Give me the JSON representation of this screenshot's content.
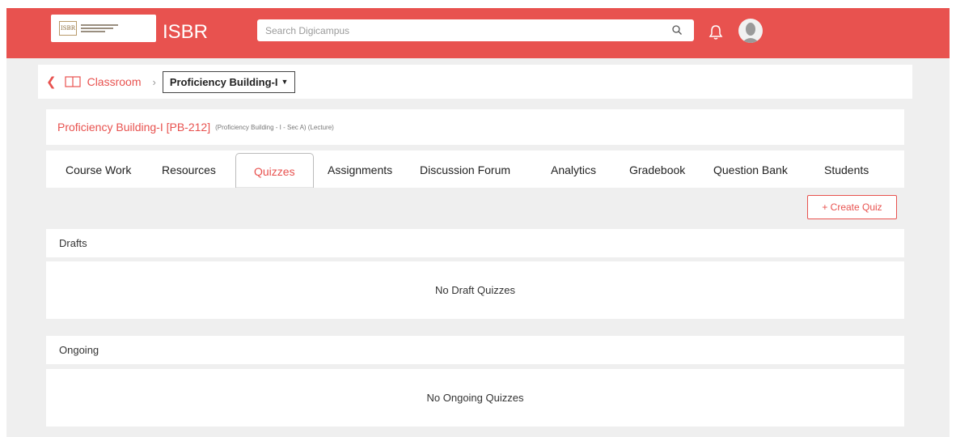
{
  "header": {
    "app_title": "ISBR",
    "logo_text": "ISBR",
    "search_placeholder": "Search Digicampus",
    "brand_color": "#e8524f"
  },
  "breadcrumb": {
    "back_icon": "chevron-left-icon",
    "classroom_label": "Classroom",
    "separator": "›",
    "course_dropdown": "Proficiency Building-I"
  },
  "course": {
    "title": "Proficiency Building-I [PB-212]",
    "meta": "(Proficiency Building - I - Sec A)  (Lecture)"
  },
  "tabs": [
    {
      "label": "Course Work"
    },
    {
      "label": "Resources"
    },
    {
      "label": "Quizzes",
      "active": true
    },
    {
      "label": "Assignments"
    },
    {
      "label": "Discussion Forum"
    },
    {
      "label": "Analytics"
    },
    {
      "label": "Gradebook"
    },
    {
      "label": "Question Bank"
    },
    {
      "label": "Students"
    }
  ],
  "actions": {
    "create_quiz": "+ Create Quiz"
  },
  "sections": {
    "drafts": {
      "title": "Drafts",
      "empty": "No Draft Quizzes"
    },
    "ongoing": {
      "title": "Ongoing",
      "empty": "No Ongoing Quizzes"
    }
  }
}
